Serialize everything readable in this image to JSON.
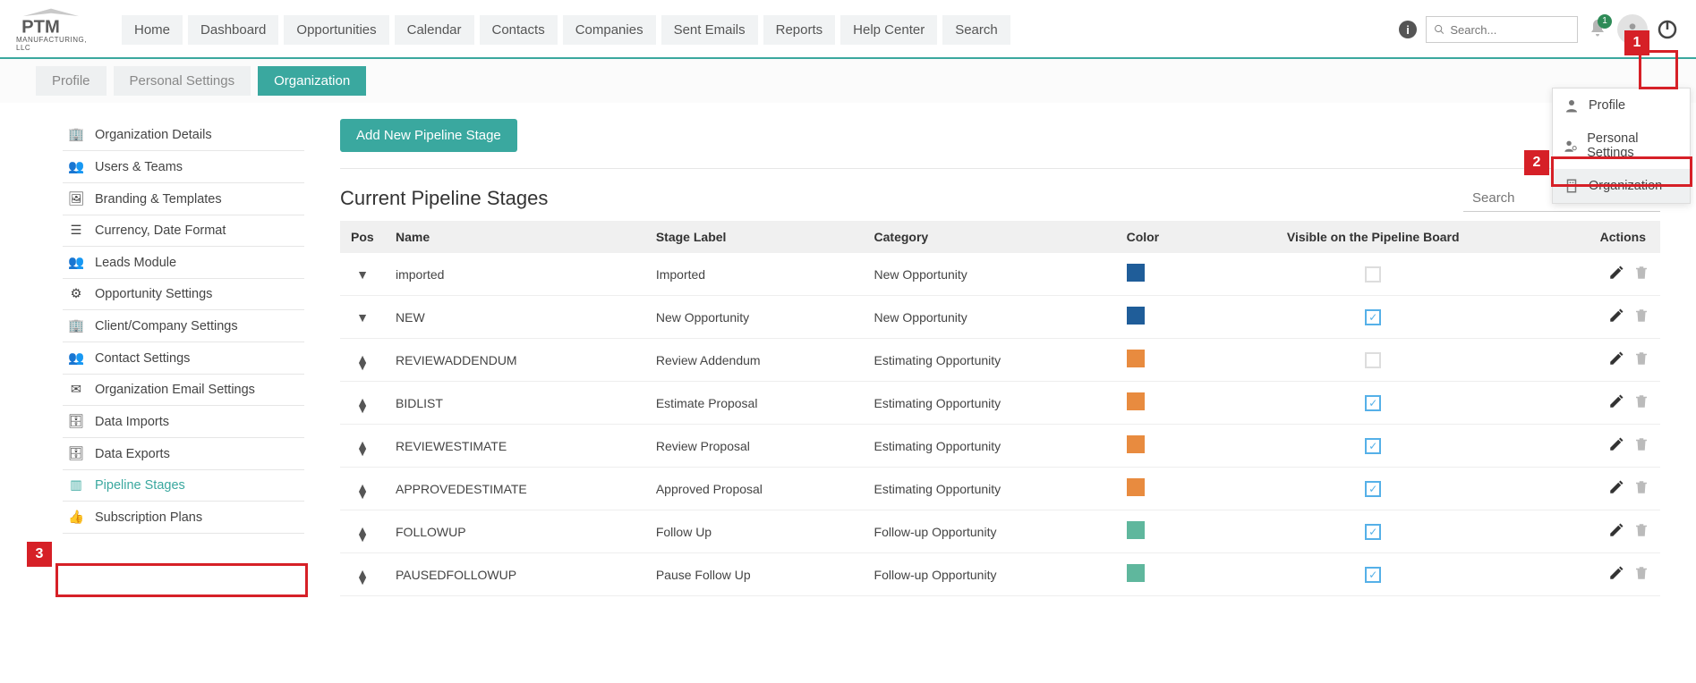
{
  "brand": {
    "name": "PTM",
    "sub": "MANUFACTURING, LLC"
  },
  "top_nav": [
    "Home",
    "Dashboard",
    "Opportunities",
    "Calendar",
    "Contacts",
    "Companies",
    "Sent Emails",
    "Reports",
    "Help Center",
    "Search"
  ],
  "search": {
    "placeholder": "Search..."
  },
  "notifications": {
    "count": "1"
  },
  "sub_tabs": [
    {
      "label": "Profile",
      "active": false
    },
    {
      "label": "Personal Settings",
      "active": false
    },
    {
      "label": "Organization",
      "active": true
    }
  ],
  "sidebar": {
    "items": [
      {
        "label": "Organization Details",
        "icon": "building"
      },
      {
        "label": "Users & Teams",
        "icon": "users"
      },
      {
        "label": "Branding & Templates",
        "icon": "image"
      },
      {
        "label": "Currency, Date Format",
        "icon": "list"
      },
      {
        "label": "Leads Module",
        "icon": "users-plus"
      },
      {
        "label": "Opportunity Settings",
        "icon": "user-gear"
      },
      {
        "label": "Client/Company Settings",
        "icon": "building"
      },
      {
        "label": "Contact Settings",
        "icon": "users-cog"
      },
      {
        "label": "Organization Email Settings",
        "icon": "mail"
      },
      {
        "label": "Data Imports",
        "icon": "db"
      },
      {
        "label": "Data Exports",
        "icon": "db"
      },
      {
        "label": "Pipeline Stages",
        "icon": "columns",
        "active": true
      },
      {
        "label": "Subscription Plans",
        "icon": "thumbs"
      }
    ]
  },
  "main": {
    "add_button": "Add New Pipeline Stage",
    "table_title": "Current Pipeline Stages",
    "table_search_placeholder": "Search",
    "columns": [
      "Pos",
      "Name",
      "Stage Label",
      "Category",
      "Color",
      "Visible on the Pipeline Board",
      "Actions"
    ],
    "rows": [
      {
        "pos": "down",
        "name": "imported",
        "label": "Imported",
        "category": "New Opportunity",
        "color": "#1f5d99",
        "visible": false
      },
      {
        "pos": "down",
        "name": "NEW",
        "label": "New Opportunity",
        "category": "New Opportunity",
        "color": "#1f5d99",
        "visible": true
      },
      {
        "pos": "both",
        "name": "REVIEWADDENDUM",
        "label": "Review Addendum",
        "category": "Estimating Opportunity",
        "color": "#e88b3f",
        "visible": false
      },
      {
        "pos": "both",
        "name": "BIDLIST",
        "label": "Estimate Proposal",
        "category": "Estimating Opportunity",
        "color": "#e88b3f",
        "visible": true
      },
      {
        "pos": "both",
        "name": "REVIEWESTIMATE",
        "label": "Review Proposal",
        "category": "Estimating Opportunity",
        "color": "#e88b3f",
        "visible": true
      },
      {
        "pos": "both",
        "name": "APPROVEDESTIMATE",
        "label": "Approved Proposal",
        "category": "Estimating Opportunity",
        "color": "#e88b3f",
        "visible": true
      },
      {
        "pos": "both",
        "name": "FOLLOWUP",
        "label": "Follow Up",
        "category": "Follow-up Opportunity",
        "color": "#5fb79d",
        "visible": true
      },
      {
        "pos": "both",
        "name": "PAUSEDFOLLOWUP",
        "label": "Pause Follow Up",
        "category": "Follow-up Opportunity",
        "color": "#5fb79d",
        "visible": true
      }
    ]
  },
  "user_menu": [
    {
      "label": "Profile",
      "icon": "user"
    },
    {
      "label": "Personal Settings",
      "icon": "user-gear"
    },
    {
      "label": "Organization",
      "icon": "building",
      "hover": true
    }
  ],
  "callouts": {
    "c1": "1",
    "c2": "2",
    "c3": "3"
  }
}
